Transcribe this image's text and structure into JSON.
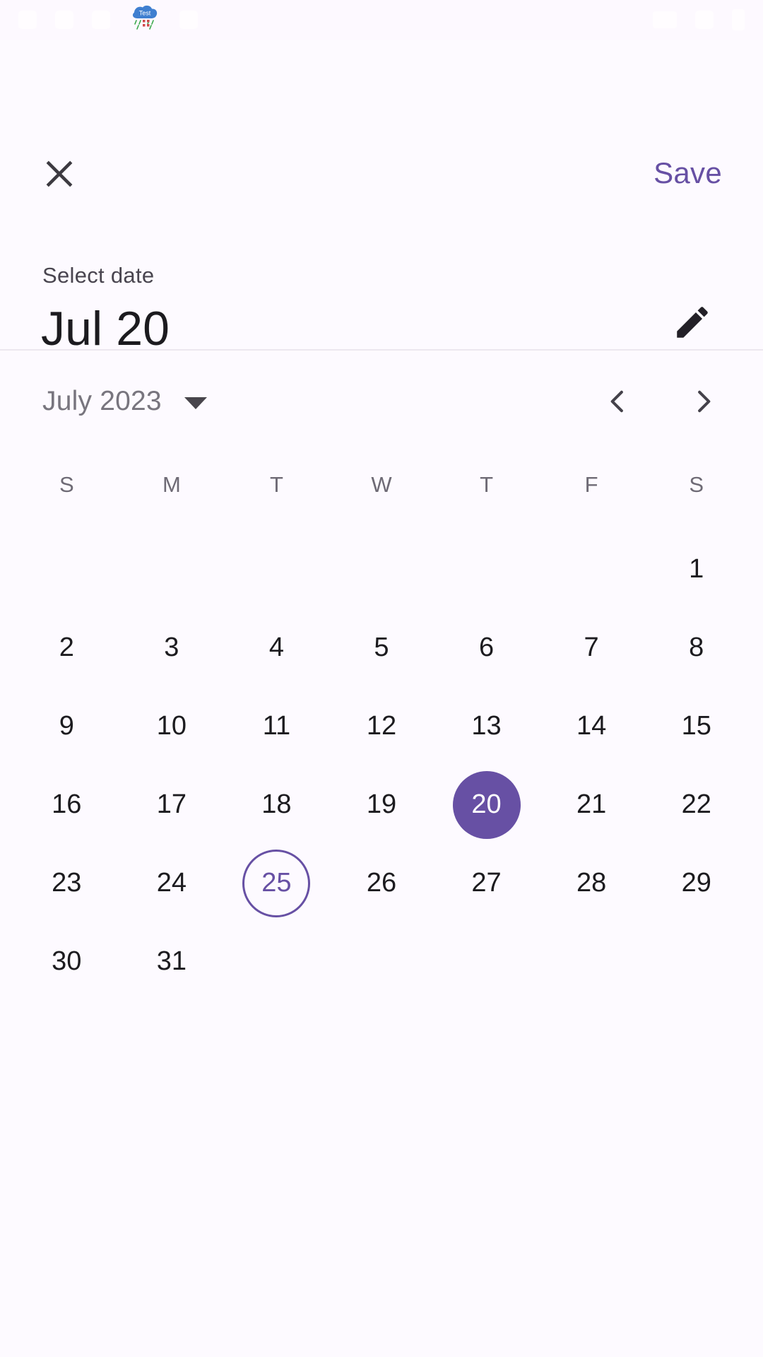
{
  "status_bar": {
    "notification_icon": "cloud-test-notification-icon",
    "notification_label": "Test",
    "left_ghost_icons": [
      "ghost-icon-1",
      "ghost-icon-2",
      "ghost-icon-3",
      "ghost-icon-4"
    ],
    "right_ghost_icons": [
      "wifi-icon",
      "signal-icon",
      "battery-icon"
    ]
  },
  "header": {
    "close_icon": "close-icon",
    "save_label": "Save",
    "supporting_text": "Select date",
    "headline_date": "Jul 20",
    "edit_icon": "pencil-edit-icon"
  },
  "calendar": {
    "month_year_label": "July 2023",
    "dropdown_icon": "chevron-down-icon",
    "prev_icon": "chevron-left-icon",
    "next_icon": "chevron-right-icon",
    "weekdays": [
      "S",
      "M",
      "T",
      "W",
      "T",
      "F",
      "S"
    ],
    "leading_blanks": 6,
    "days": [
      "1",
      "2",
      "3",
      "4",
      "5",
      "6",
      "7",
      "8",
      "9",
      "10",
      "11",
      "12",
      "13",
      "14",
      "15",
      "16",
      "17",
      "18",
      "19",
      "20",
      "21",
      "22",
      "23",
      "24",
      "25",
      "26",
      "27",
      "28",
      "29",
      "30",
      "31"
    ],
    "selected_day": "20",
    "today_day": "25"
  },
  "colors": {
    "accent": "#6750a4",
    "surface": "#fdfaff",
    "on_surface": "#1c1b1f",
    "on_surface_variant": "#49454f",
    "outline": "#ece7ef"
  }
}
